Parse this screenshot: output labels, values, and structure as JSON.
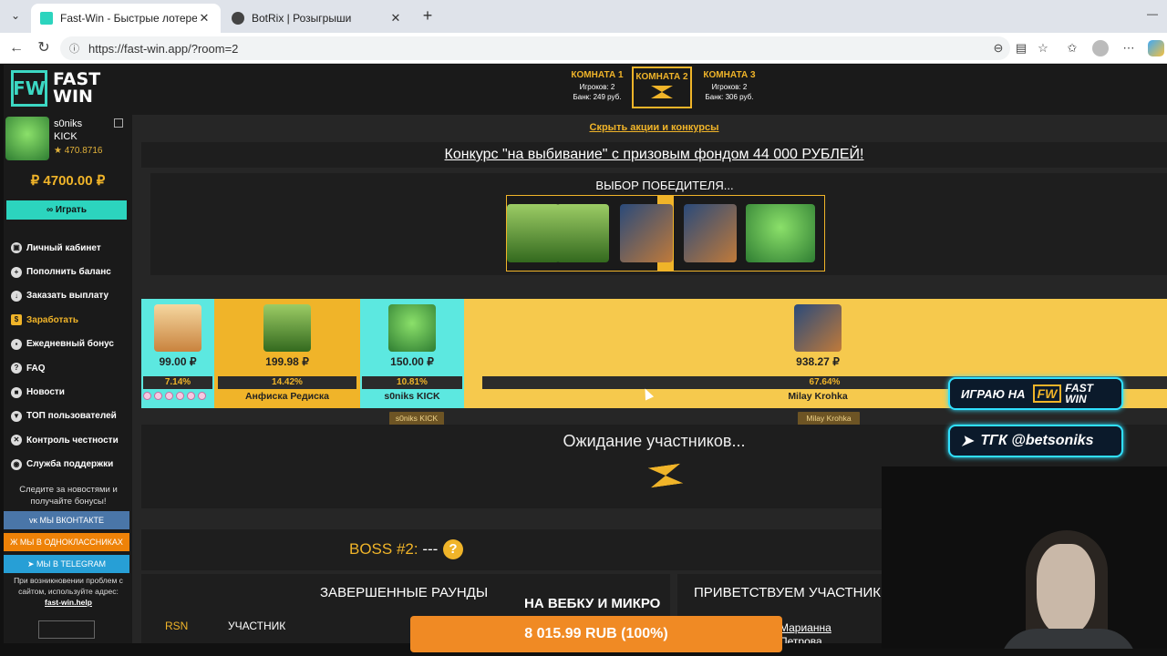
{
  "browser": {
    "tabs": [
      {
        "label": "Fast-Win - Быстрые лотереи! Ком",
        "close": "✕"
      },
      {
        "label": "BotRix | Розыгрыши",
        "close": "✕"
      }
    ],
    "new_tab": "+",
    "url": "https://fast-win.app/?room=2",
    "icons": [
      "tab-list-icon",
      "back-icon",
      "reload-icon",
      "site-info-icon",
      "zoom-icon",
      "reader-icon",
      "favorite-icon",
      "favorites-list-icon",
      "profile-icon",
      "more-icon",
      "copilot-icon"
    ]
  },
  "sidebar": {
    "logo_mark": "FW",
    "logo_line1": "FAST",
    "logo_line2": "WIN",
    "user_name": "s0niks",
    "user_sub": "KICK",
    "rating": "★ 470.8716",
    "balance": "₽ 4700.00 ₽",
    "play_label": "∞ Играть",
    "menu": [
      {
        "label": "Личный кабинет",
        "icon": "wallet-icon",
        "glyph": "▣"
      },
      {
        "label": "Пополнить баланс",
        "icon": "deposit-icon",
        "glyph": "+"
      },
      {
        "label": "Заказать выплату",
        "icon": "withdraw-icon",
        "glyph": "↓"
      },
      {
        "label": "Заработать",
        "icon": "earn-icon",
        "glyph": "$"
      },
      {
        "label": "Ежедневный бонус",
        "icon": "gift-icon",
        "glyph": "▪"
      },
      {
        "label": "FAQ",
        "icon": "question-icon",
        "glyph": "?"
      },
      {
        "label": "Новости",
        "icon": "bookmark-icon",
        "glyph": "■"
      },
      {
        "label": "ТОП пользователей",
        "icon": "trophy-icon",
        "glyph": "▼"
      },
      {
        "label": "Контроль честности",
        "icon": "shuffle-icon",
        "glyph": "✕"
      },
      {
        "label": "Служба поддержки",
        "icon": "support-icon",
        "glyph": "◉"
      }
    ],
    "news_note": "Следите за новостями и получайте бонусы!",
    "social": [
      {
        "label": "ᴠᴋ МЫ ВКОНТАКТЕ",
        "color": "#4a76a8"
      },
      {
        "label": "Ж МЫ В ОДНОКЛАССНИКАХ",
        "color": "#ee8208"
      },
      {
        "label": "➤ МЫ В TELEGRAM",
        "color": "#279fd6"
      }
    ],
    "help_note": "При возникновении проблем с сайтом, используйте адрес:",
    "help_link": "fast-win.help"
  },
  "rooms": [
    {
      "title": "КОМНАТА 1",
      "players": "Игроков: 2",
      "bank": "Банк: 249 руб.",
      "active": false
    },
    {
      "title": "КОМНАТА 2",
      "active": true
    },
    {
      "title": "КОМНАТА 3",
      "players": "Игроков: 2",
      "bank": "Банк: 306 руб.",
      "active": false
    }
  ],
  "promo_toggle": "Скрыть акции и конкурсы",
  "contest_text": "Конкурс \"на выбивание\" с призовым фондом 44 000 РУБЛЕЙ!",
  "winner_title": "ВЫБОР ПОБЕДИТЕЛЯ...",
  "players": [
    {
      "amount": "99.00 ₽",
      "percent": "7.14%",
      "share": 0.0714,
      "name": "",
      "bg": "#5ce8e0"
    },
    {
      "amount": "199.98 ₽",
      "percent": "14.42%",
      "share": 0.1442,
      "name": "Анфиска Редиска",
      "bg": "#f0b429"
    },
    {
      "amount": "150.00 ₽",
      "percent": "10.81%",
      "share": 0.1081,
      "name": "s0niks KICK",
      "bg": "#5ce8e0",
      "tag": "s0niks KICK"
    },
    {
      "amount": "938.27 ₽",
      "percent": "67.64%",
      "share": 0.6764,
      "name": "Milay Krohka",
      "bg": "#f6c94d",
      "tag": "Milay Krohka"
    }
  ],
  "waiting_text": "Ожидание участников...",
  "boss_label": "BOSS #2:",
  "boss_value": "---",
  "boss_help": "?",
  "rounds_title": "ЗАВЕРШЕННЫЕ РАУНДЫ",
  "rounds_cols": [
    "RSN",
    "УЧАСТНИК"
  ],
  "welcome_title": "ПРИВЕТСТВУЕМ УЧАСТНИК",
  "welcome_name_1": "Марианна",
  "welcome_name_2": "Петрова",
  "overlay": {
    "badge1_text": "ИГРАЮ НА",
    "badge1_mark": "FW",
    "badge1_line1": "FAST",
    "badge1_line2": "WIN",
    "badge2_text": "ТГК @betsoniks",
    "cam_caption": "НА ВЕБКУ И МИКРО",
    "bank_text": "8 015.99 RUB (100%)"
  }
}
